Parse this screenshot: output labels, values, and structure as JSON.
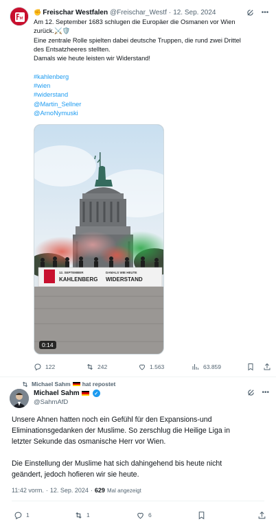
{
  "quoted_tweet": {
    "display_name": "Freischar Westfalen",
    "handle": "@Freischar_Westf",
    "separator": "·",
    "date": "12. Sep. 2024",
    "text_lines": [
      "Am 12. September 1683 schlugen die Europäer die Osmanen vor Wien",
      "zurück.⚔️🛡️",
      "Eine zentrale Rolle spielten dabei deutsche Truppen, die rund zwei Drittel",
      "des Entsatzheeres stellten.",
      "Damals wie heute leisten wir Widerstand!",
      ""
    ],
    "links": [
      "#kahlenberg",
      "#wien",
      "#widerstand",
      "@Martin_Sellner",
      "@ArnoNymuski"
    ],
    "video": {
      "duration": "0:14",
      "banner_left": "KAHLENBERG",
      "banner_left_small": "12. SEPTEMBER",
      "banner_right": "WIDERSTAND",
      "banner_right_small": "DAMALS WIE HEUTE"
    },
    "stats": {
      "replies": "122",
      "reposts": "242",
      "likes": "1.563",
      "views": "63.859"
    }
  },
  "repost_header": {
    "name": "Michael Sahm",
    "suffix": "hat repostet"
  },
  "main_tweet": {
    "display_name": "Michael Sahm",
    "handle": "@SahmAfD",
    "text_lines": [
      "Unsere Ahnen hatten noch ein Gefühl für den Expansions-und",
      "Eliminationsgedanken der Muslime. So zerschlug die Heilige Liga in",
      "letzter Sekunde das osmanische Herr vor Wien.",
      "",
      "Die Einstellung der Muslime hat sich dahingehend bis heute nicht",
      "geändert, jedoch hofieren wir sie heute."
    ],
    "time": "11:42 vorm.",
    "separator": "·",
    "date": "12. Sep. 2024",
    "separator2": "·",
    "view_count": "629",
    "view_label": "Mal angezeigt",
    "stats": {
      "replies": "1",
      "reposts": "1",
      "likes": "6"
    }
  },
  "colors": {
    "accent": "#1d9bf0",
    "muted": "#536471",
    "avatar_red": "#c8102e"
  },
  "icons": [
    "grok-icon",
    "more-icon",
    "reply-icon",
    "repost-icon",
    "like-icon",
    "views-icon",
    "bookmark-icon",
    "share-icon",
    "verified-icon",
    "german-flag-icon"
  ]
}
